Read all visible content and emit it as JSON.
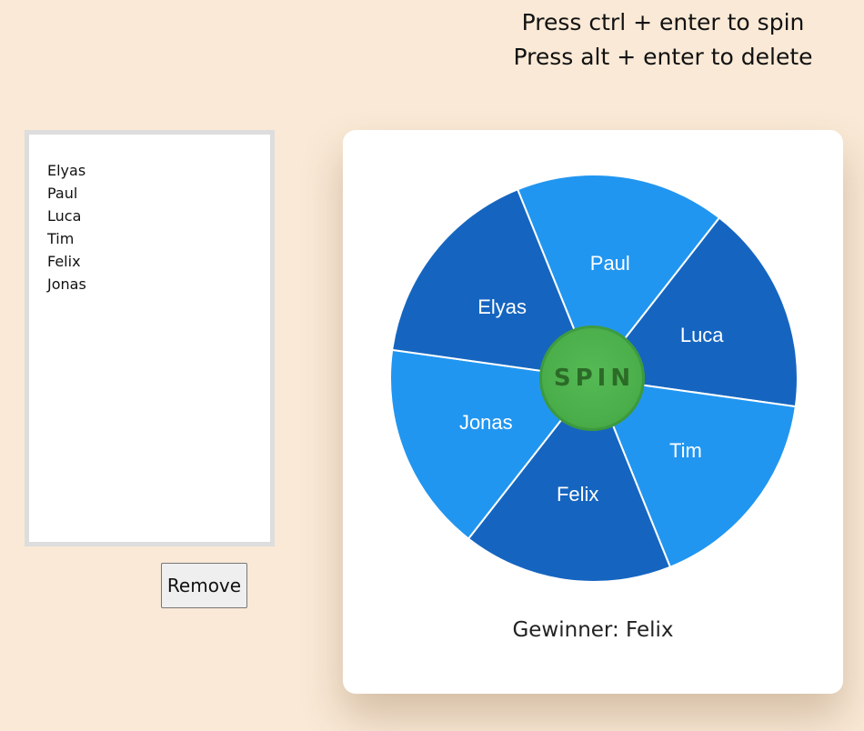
{
  "hints": {
    "spin": "Press ctrl + enter to spin",
    "delete": "Press alt + enter to delete"
  },
  "names_list": [
    "Elyas",
    "Paul",
    "Luca",
    "Tim",
    "Felix",
    "Jonas"
  ],
  "remove_button": "Remove",
  "wheel": {
    "spin_label": "SPIN",
    "segments": [
      {
        "label": "Paul",
        "color": "#2196f0"
      },
      {
        "label": "Luca",
        "color": "#1565c0"
      },
      {
        "label": "Tim",
        "color": "#2196f0"
      },
      {
        "label": "Felix",
        "color": "#1565c0"
      },
      {
        "label": "Jonas",
        "color": "#2196f0"
      },
      {
        "label": "Elyas",
        "color": "#1565c0"
      }
    ]
  },
  "result": {
    "winner_text": "Gewinner: Felix"
  },
  "colors": {
    "background": "#f9e9d6",
    "spin_button": "#4caf50",
    "segment_light": "#2196f0",
    "segment_dark": "#1565c0"
  }
}
